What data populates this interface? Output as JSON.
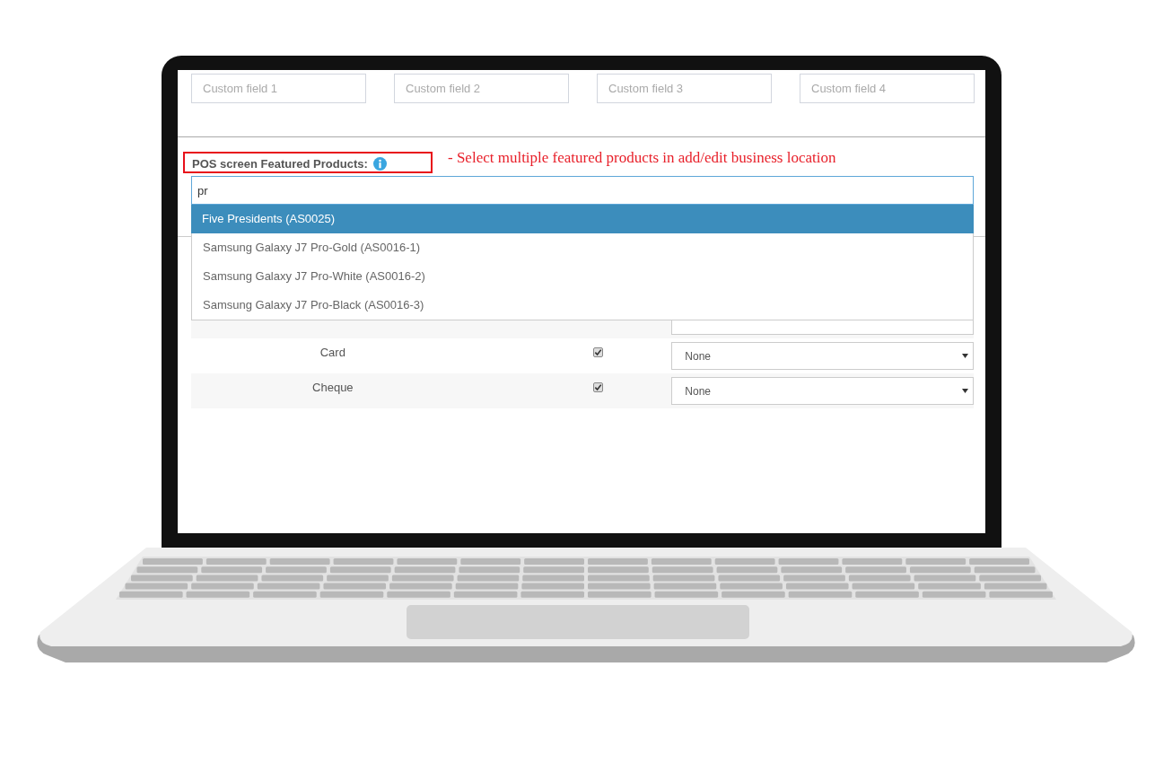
{
  "custom_fields": [
    {
      "placeholder": "Custom field 1"
    },
    {
      "placeholder": "Custom field 2"
    },
    {
      "placeholder": "Custom field 3"
    },
    {
      "placeholder": "Custom field 4"
    }
  ],
  "featured_products": {
    "label": "POS screen Featured Products:",
    "highlighted": true,
    "annotation": "- Select multiple featured products in add/edit business location",
    "search": {
      "value": "pr"
    },
    "options": [
      {
        "label": "Five Presidents (AS0025)",
        "selected": true
      },
      {
        "label": "Samsung Galaxy J7 Pro-Gold (AS0016-1)",
        "selected": false
      },
      {
        "label": "Samsung Galaxy J7 Pro-White (AS0016-2)",
        "selected": false
      },
      {
        "label": "Samsung Galaxy J7 Pro-Black (AS0016-3)",
        "selected": false
      }
    ]
  },
  "payment_rows": [
    {
      "method": "Card",
      "checked": true,
      "account": "None"
    },
    {
      "method": "Cheque",
      "checked": true,
      "account": "None"
    }
  ]
}
